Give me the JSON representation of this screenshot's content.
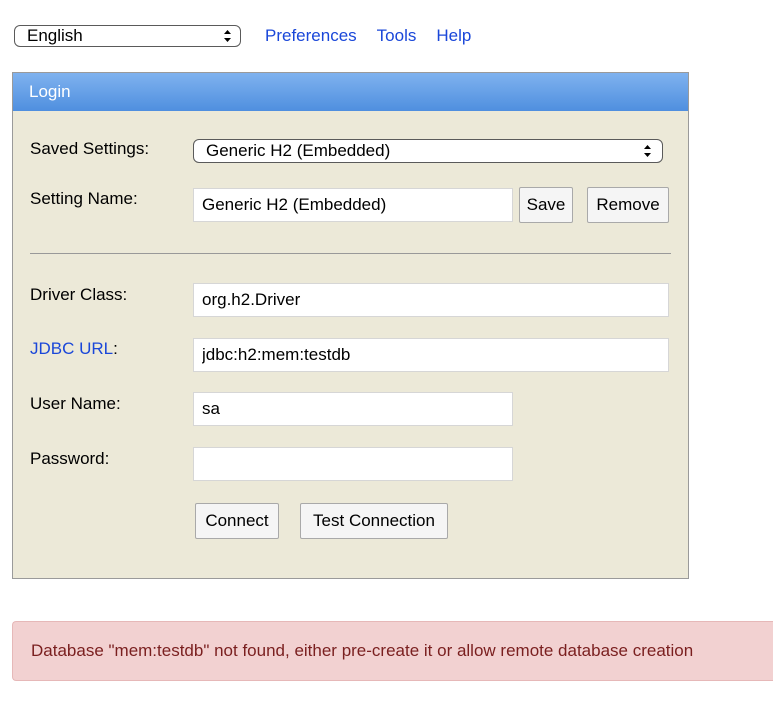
{
  "topbar": {
    "language": "English",
    "links": [
      "Preferences",
      "Tools",
      "Help"
    ]
  },
  "login": {
    "title": "Login",
    "saved_settings_label": "Saved Settings:",
    "saved_settings_value": "Generic H2 (Embedded)",
    "setting_name_label": "Setting Name:",
    "setting_name_value": "Generic H2 (Embedded)",
    "save_label": "Save",
    "remove_label": "Remove",
    "driver_class_label": "Driver Class:",
    "driver_class_value": "org.h2.Driver",
    "jdbc_url_label": "JDBC URL",
    "jdbc_url_colon": ":",
    "jdbc_url_value": "jdbc:h2:mem:testdb",
    "user_name_label": "User Name:",
    "user_name_value": "sa",
    "password_label": "Password:",
    "password_value": "",
    "connect_label": "Connect",
    "test_connection_label": "Test Connection"
  },
  "error": {
    "message": "Database \"mem:testdb\" not found, either pre-create it or allow remote database creation"
  },
  "colors": {
    "link": "#1a47d9",
    "panel_bg": "#ece9d8",
    "header_bg": "#5a98e4",
    "error_bg": "#f2d1d1",
    "error_text": "#7a1f1f"
  }
}
